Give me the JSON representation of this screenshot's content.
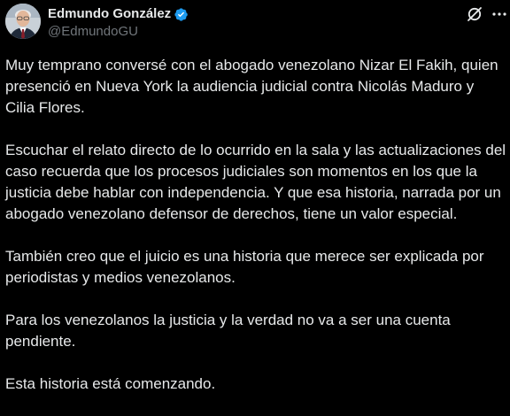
{
  "author": {
    "display_name": "Edmundo González",
    "handle": "@EdmundoGU",
    "avatar_icon": "profile-photo",
    "verified_icon": "verified-badge-icon",
    "verified_color": "#1d9bf0"
  },
  "header_icons": {
    "grok": "grok-icon",
    "more": "more-icon"
  },
  "tweet": {
    "paragraphs": [
      "Muy temprano conversé con el abogado venezolano Nizar El Fakih, quien presenció en Nueva York la audiencia judicial contra Nicolás Maduro y Cilia Flores.",
      "Escuchar el relato directo de lo ocurrido en la sala y las actualizaciones del caso recuerda que los procesos judiciales son momentos en los que la justicia debe hablar con independencia. Y que esa historia, narrada por un abogado venezolano defensor de derechos, tiene un valor especial.",
      "También creo que el juicio es una historia que merece ser explicada por periodistas y medios venezolanos.",
      "Para los venezolanos la justicia y la verdad no va a ser una cuenta pendiente.",
      "Esta historia está comenzando."
    ]
  },
  "colors": {
    "background": "#000000",
    "primary_text": "#e7e9ea",
    "secondary_text": "#71767b"
  }
}
